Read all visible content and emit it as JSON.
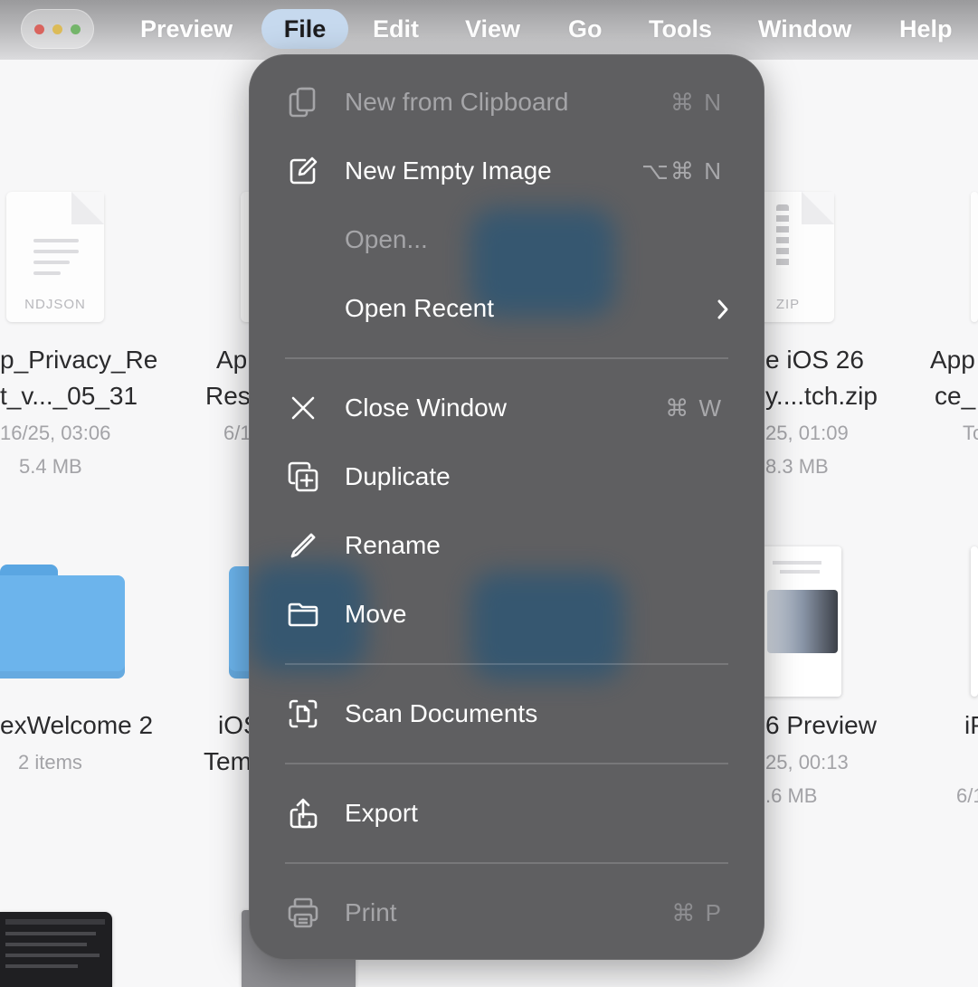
{
  "menubar": {
    "items": [
      "Preview",
      "File",
      "Edit",
      "View",
      "Go",
      "Tools",
      "Window",
      "Help"
    ],
    "active": "File"
  },
  "file_menu": {
    "items": [
      {
        "label": "New from Clipboard",
        "shortcut": "⌘ N",
        "icon": "clipboard-icon",
        "enabled": false
      },
      {
        "label": "New Empty Image",
        "shortcut": "⌥⌘ N",
        "icon": "compose-icon",
        "enabled": true
      },
      {
        "label": "Open...",
        "shortcut": "",
        "icon": "",
        "enabled": false
      },
      {
        "label": "Open Recent",
        "shortcut": "",
        "icon": "",
        "enabled": true,
        "submenu": true
      },
      {
        "label": "Close Window",
        "shortcut": "⌘ W",
        "icon": "close-icon",
        "enabled": true
      },
      {
        "label": "Duplicate",
        "shortcut": "",
        "icon": "duplicate-icon",
        "enabled": true
      },
      {
        "label": "Rename",
        "shortcut": "",
        "icon": "pencil-icon",
        "enabled": true
      },
      {
        "label": "Move",
        "shortcut": "",
        "icon": "folder-icon",
        "enabled": true
      },
      {
        "label": "Scan Documents",
        "shortcut": "",
        "icon": "scan-document-icon",
        "enabled": true
      },
      {
        "label": "Export",
        "shortcut": "",
        "icon": "share-icon",
        "enabled": true
      },
      {
        "label": "Print",
        "shortcut": "⌘ P",
        "icon": "printer-icon",
        "enabled": false
      }
    ]
  },
  "background_files": [
    {
      "line1": "p_Privacy_Re",
      "line2": "t_v..._05_31",
      "date": "16/25, 03:06",
      "size": "5.4 MB",
      "tag": "NDJSON"
    },
    {
      "line1": "Ap",
      "line2": "Res",
      "date": "6/1",
      "size": ""
    },
    {
      "line1": "e iOS 26",
      "line2": "y....tch.zip",
      "date": "25, 01:09",
      "size": "8.3 MB",
      "tag": "ZIP"
    },
    {
      "line1": "App",
      "line2": "ce_",
      "date": "To",
      "size": ""
    },
    {
      "line1": "exWelcome 2",
      "line2": "",
      "date": "2 items",
      "size": ""
    },
    {
      "line1": "iOS",
      "line2": "Tem",
      "date": "",
      "size": ""
    },
    {
      "line1": "6 Preview",
      "line2": "",
      "date": "25, 00:13",
      "size": ".6 MB"
    },
    {
      "line1": "iP",
      "line2": "",
      "date": "6/1",
      "size": ""
    }
  ],
  "colors": {
    "menu_bg": "#5f5f61",
    "active_menu_highlight": "#c6d9ee",
    "folder": "#6cb4ec"
  }
}
